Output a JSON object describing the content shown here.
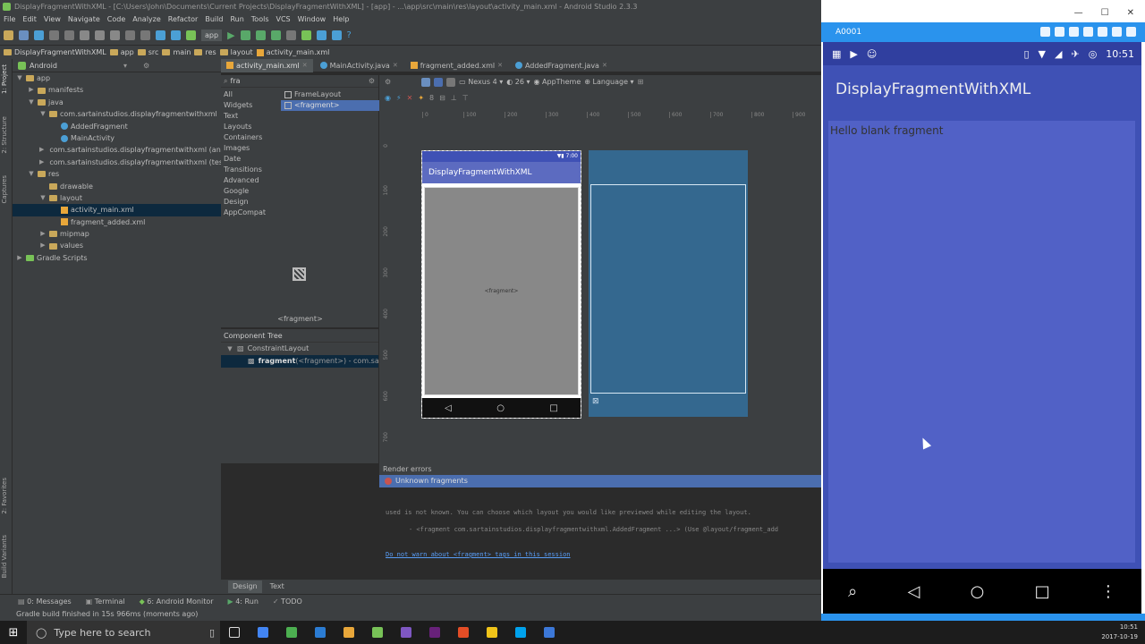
{
  "window": {
    "title": "DisplayFragmentWithXML - [C:\\Users\\John\\Documents\\Current Projects\\DisplayFragmentWithXML] - [app] - ...\\app\\src\\main\\res\\layout\\activity_main.xml - Android Studio 2.3.3"
  },
  "menu": [
    "File",
    "Edit",
    "View",
    "Navigate",
    "Code",
    "Analyze",
    "Refactor",
    "Build",
    "Run",
    "Tools",
    "VCS",
    "Window",
    "Help"
  ],
  "toolbar": {
    "run_config": "app"
  },
  "breadcrumb": [
    "DisplayFragmentWithXML",
    "app",
    "src",
    "main",
    "res",
    "layout",
    "activity_main.xml"
  ],
  "project": {
    "view_selector": "Android",
    "tree": [
      {
        "label": "app",
        "level": 0,
        "arrow": "▼",
        "icon": "folder"
      },
      {
        "label": "manifests",
        "level": 1,
        "arrow": "▶",
        "icon": "folder"
      },
      {
        "label": "java",
        "level": 1,
        "arrow": "▼",
        "icon": "folder"
      },
      {
        "label": "com.sartainstudios.displayfragmentwithxml",
        "level": 2,
        "arrow": "▼",
        "icon": "folder"
      },
      {
        "label": "AddedFragment",
        "level": 3,
        "arrow": "",
        "icon": "class"
      },
      {
        "label": "MainActivity",
        "level": 3,
        "arrow": "",
        "icon": "class"
      },
      {
        "label": "com.sartainstudios.displayfragmentwithxml (andr",
        "level": 2,
        "arrow": "▶",
        "icon": "folder"
      },
      {
        "label": "com.sartainstudios.displayfragmentwithxml (test)",
        "level": 2,
        "arrow": "▶",
        "icon": "folder"
      },
      {
        "label": "res",
        "level": 1,
        "arrow": "▼",
        "icon": "folder"
      },
      {
        "label": "drawable",
        "level": 2,
        "arrow": "",
        "icon": "folder"
      },
      {
        "label": "layout",
        "level": 2,
        "arrow": "▼",
        "icon": "folder"
      },
      {
        "label": "activity_main.xml",
        "level": 3,
        "arrow": "",
        "icon": "xml",
        "selected": true
      },
      {
        "label": "fragment_added.xml",
        "level": 3,
        "arrow": "",
        "icon": "xml"
      },
      {
        "label": "mipmap",
        "level": 2,
        "arrow": "▶",
        "icon": "folder"
      },
      {
        "label": "values",
        "level": 2,
        "arrow": "▶",
        "icon": "folder"
      },
      {
        "label": "Gradle Scripts",
        "level": 0,
        "arrow": "▶",
        "icon": "gradle"
      }
    ]
  },
  "left_tool_tabs": [
    "1: Project",
    "2: Structure",
    "Captures",
    "2: Favorites",
    "Build Variants"
  ],
  "editor_tabs": [
    {
      "label": "activity_main.xml",
      "active": true
    },
    {
      "label": "MainActivity.java",
      "active": false
    },
    {
      "label": "fragment_added.xml",
      "active": false
    },
    {
      "label": "AddedFragment.java",
      "active": false
    }
  ],
  "palette": {
    "search": "fra",
    "categories": [
      "All",
      "Widgets",
      "Text",
      "Layouts",
      "Containers",
      "Images",
      "Date",
      "Transitions",
      "Advanced",
      "Google",
      "Design",
      "AppCompat"
    ],
    "items": [
      {
        "label": "FrameLayout",
        "selected": false
      },
      {
        "label": "<fragment>",
        "selected": true
      }
    ],
    "preview_label": "<fragment>"
  },
  "component_tree": {
    "title": "Component Tree",
    "root": "ConstraintLayout",
    "child_bold": "fragment",
    "child_rest": " (<fragment>) - com.sartai"
  },
  "design_toolbar": {
    "device": "Nexus 4",
    "api": "26",
    "theme": "AppTheme",
    "language": "Language"
  },
  "rulers": {
    "h": [
      "0",
      "100",
      "200",
      "300",
      "400",
      "500",
      "600",
      "700",
      "800",
      "900"
    ],
    "v": [
      "0",
      "100",
      "200",
      "300",
      "400",
      "500",
      "600",
      "700"
    ]
  },
  "preview": {
    "status_time": "7:00",
    "app_title": "DisplayFragmentWithXML",
    "fragment_label": "<fragment>",
    "nav": [
      "◁",
      "○",
      "□"
    ]
  },
  "render_errors": {
    "title": "Render errors",
    "header": "Unknown fragments",
    "lines": [
      "used is not known. You can choose which layout you would like previewed while editing the layout.",
      "- <fragment com.sartainstudios.displayfragmentwithxml.AddedFragment ...> (Use @layout/fragment_add"
    ],
    "link": "Do not warn about <fragment> tags in this session"
  },
  "design_tabs": [
    {
      "label": "Design",
      "active": true
    },
    {
      "label": "Text",
      "active": false
    }
  ],
  "bottom_tools": [
    "0: Messages",
    "Terminal",
    "6: Android Monitor",
    "4: Run",
    "TODO"
  ],
  "status": "Gradle build finished in 15s 966ms (moments ago)",
  "emulator": {
    "window_controls": [
      "—",
      "☐",
      "✕"
    ],
    "device_name": "A0001",
    "android_time": "10:51",
    "app_title": "DisplayFragmentWithXML",
    "fragment_text": "Hello blank fragment",
    "nav": [
      "⌕",
      "◁",
      "○",
      "□",
      "⋮"
    ]
  },
  "taskbar": {
    "search_placeholder": "Type here to search",
    "time": "10:51",
    "date": "2017-10-19",
    "app_colors": [
      "#4285f4",
      "#4caf50",
      "#2b7cd3",
      "#e8a73a",
      "#78c257",
      "#7e57c2",
      "#68217a",
      "#e44d26",
      "#f0c419",
      "#00a2ed",
      "#3c78d8"
    ]
  }
}
